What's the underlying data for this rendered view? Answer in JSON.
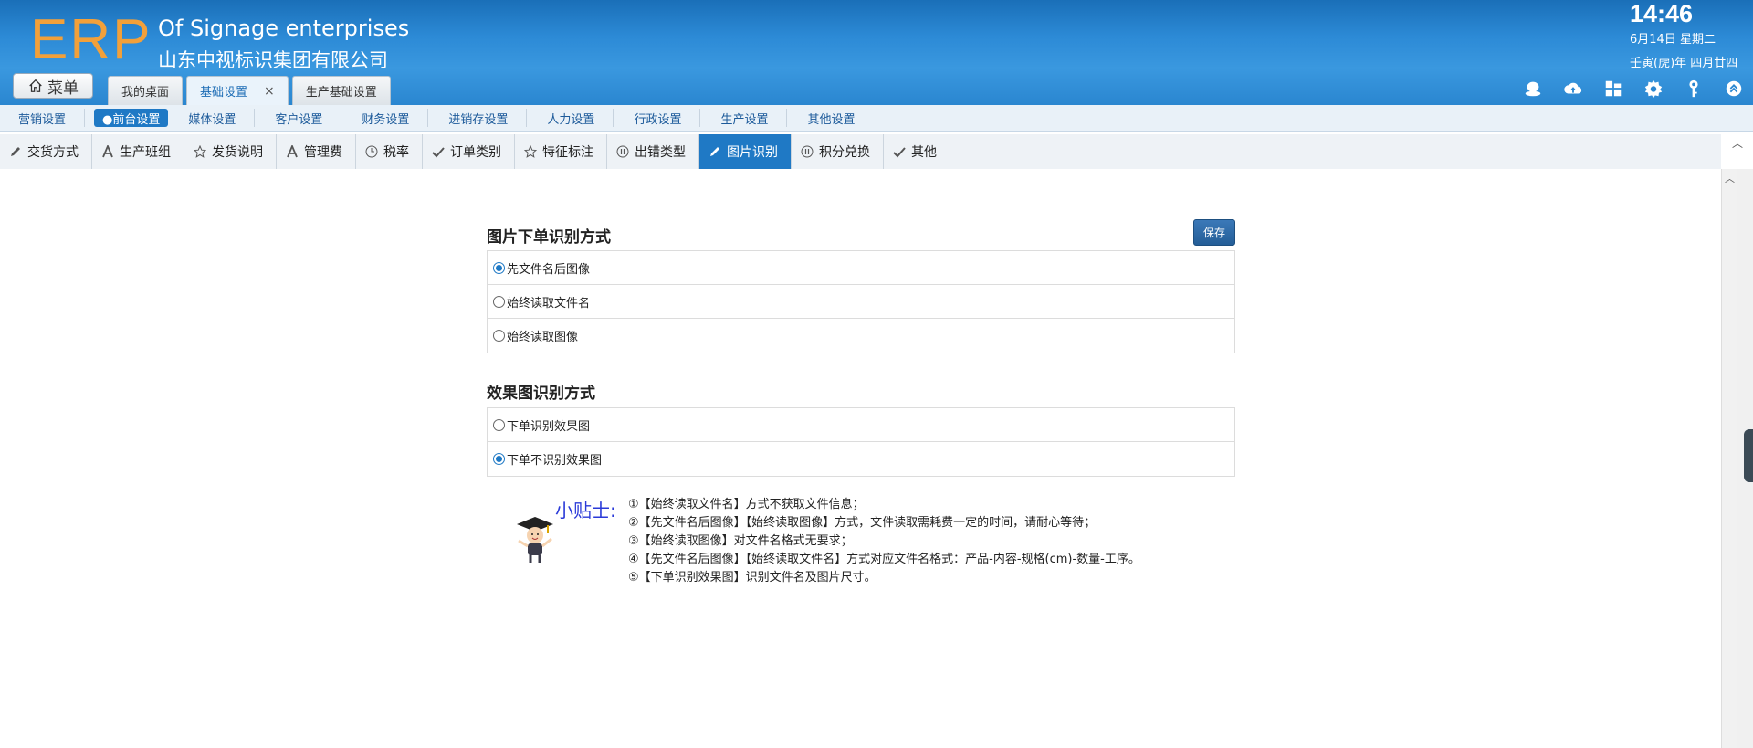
{
  "header": {
    "logo": "ERP",
    "company_en": "Of Signage enterprises",
    "company_cn": "山东中视标识集团有限公司",
    "time": "14:46",
    "date": "6月14日 星期二",
    "lunar": "壬寅(虎)年 四月廿四",
    "menu_label": "菜单",
    "tabs": [
      {
        "label": "我的桌面"
      },
      {
        "label": "基础设置",
        "close": "×"
      },
      {
        "label": "生产基础设置"
      }
    ],
    "icons": [
      "user-icon",
      "cloud-upload-icon",
      "apps-icon",
      "gear-icon",
      "key-icon",
      "collapse-up-icon"
    ]
  },
  "categories": [
    "营销设置",
    "●前台设置",
    "媒体设置",
    "客户设置",
    "财务设置",
    "进销存设置",
    "人力设置",
    "行政设置",
    "生产设置",
    "其他设置"
  ],
  "subtabs": [
    {
      "label": "交货方式",
      "icon": "pencil-icon"
    },
    {
      "label": "生产班组",
      "icon": "font-a-icon"
    },
    {
      "label": "发货说明",
      "icon": "star-icon"
    },
    {
      "label": "管理费",
      "icon": "font-a-icon"
    },
    {
      "label": "税率",
      "icon": "clock-icon"
    },
    {
      "label": "订单类别",
      "icon": "check-icon"
    },
    {
      "label": "特征标注",
      "icon": "star-icon"
    },
    {
      "label": "出错类型",
      "icon": "pause-circle-icon"
    },
    {
      "label": "图片识别",
      "icon": "pencil-icon"
    },
    {
      "label": "积分兑换",
      "icon": "pause-circle-icon"
    },
    {
      "label": "其他",
      "icon": "check-icon"
    }
  ],
  "main": {
    "section1_title": "图片下单识别方式",
    "save_label": "保存",
    "section1_options": [
      {
        "label": "先文件名后图像",
        "checked": true
      },
      {
        "label": "始终读取文件名",
        "checked": false
      },
      {
        "label": "始终读取图像",
        "checked": false
      }
    ],
    "section2_title": "效果图识别方式",
    "section2_options": [
      {
        "label": "下单识别效果图",
        "checked": false
      },
      {
        "label": "下单不识别效果图",
        "checked": true
      }
    ],
    "tips_title": "小贴士:",
    "tips": [
      "①【始终读取文件名】方式不获取文件信息；",
      "②【先文件名后图像】【始终读取图像】方式，文件读取需耗费一定的时间，请耐心等待；",
      "③【始终读取图像】对文件名格式无要求；",
      "④【先文件名后图像】【始终读取文件名】方式对应文件名格式：产品-内容-规格(cm)-数量-工序。",
      "⑤【下单识别效果图】识别文件名及图片尺寸。"
    ]
  }
}
